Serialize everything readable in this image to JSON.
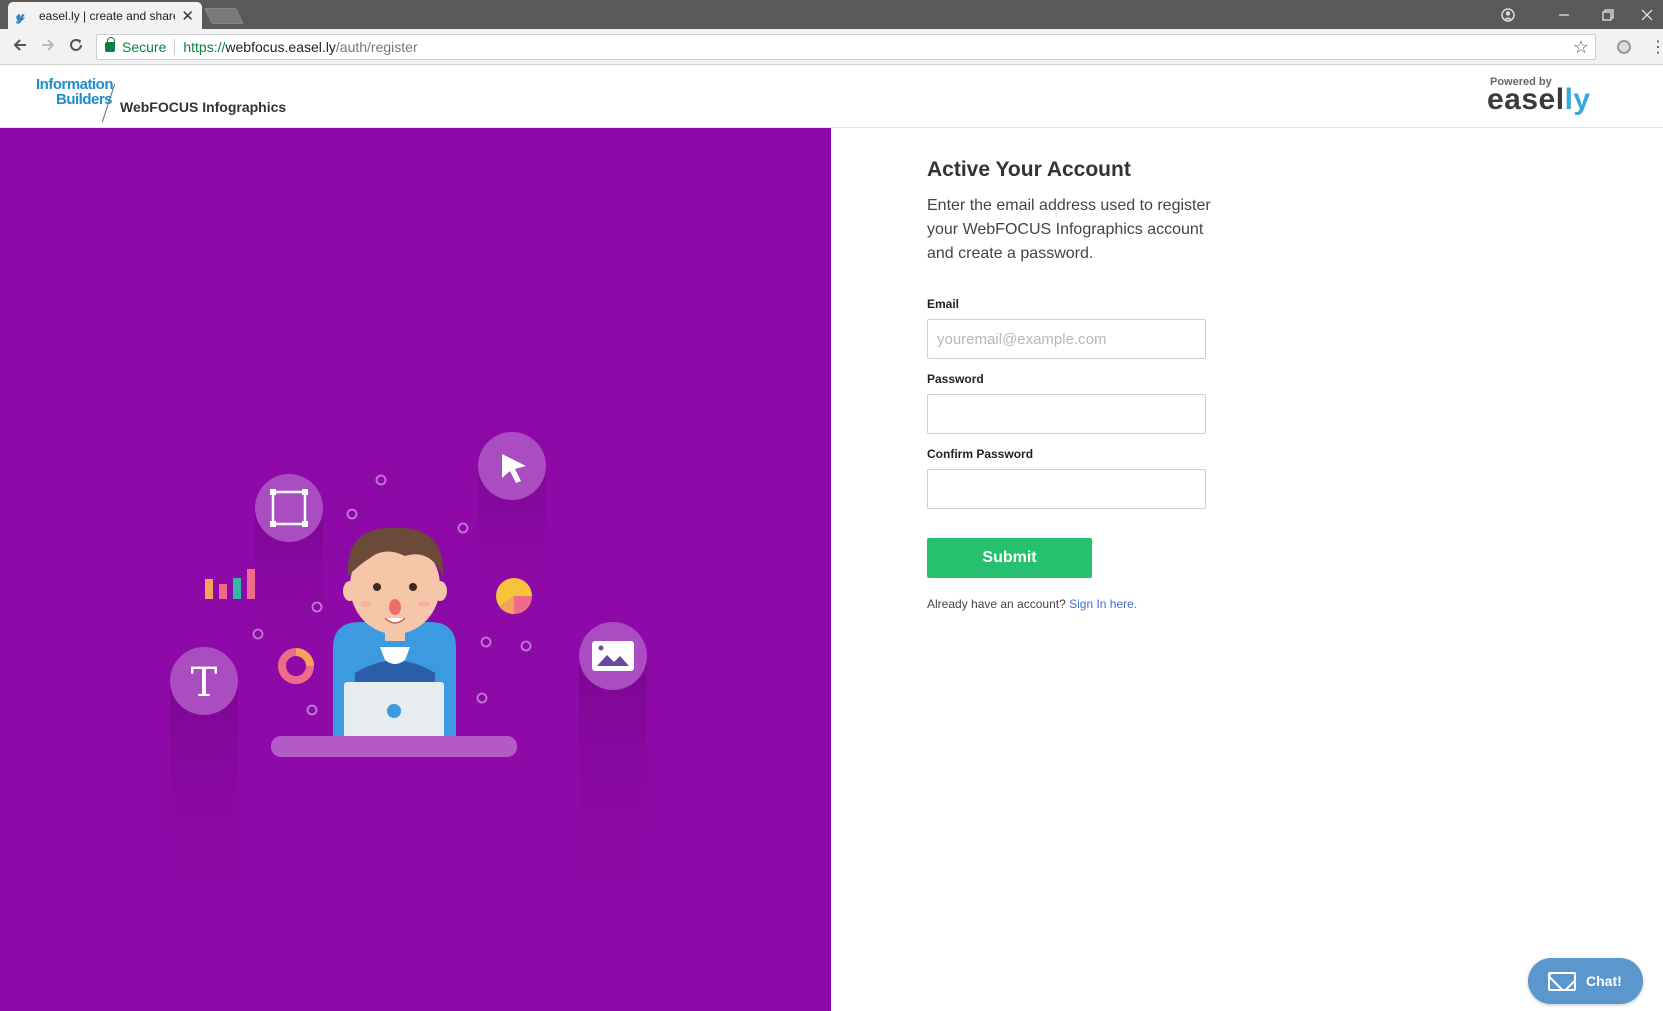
{
  "browser": {
    "tab_title": "easel.ly | create and share",
    "tab_close": "✕",
    "secure_label": "Secure",
    "url_scheme": "https://",
    "url_host": "webfocus.easel.ly",
    "url_path": "/auth/register"
  },
  "header": {
    "ib_logo_line1": "Information",
    "ib_logo_line2": "Builders",
    "product_name": "WebFOCUS Infographics",
    "powered_by": "Powered by",
    "brand_main": "easel",
    "brand_accent": "ly"
  },
  "hero": {
    "text_bubble_glyph": "T",
    "bg_color": "#8e0aa8"
  },
  "form": {
    "title": "Active Your Account",
    "description": "Enter the email address used to register your WebFOCUS Infographics account and create a password.",
    "email_label": "Email",
    "email_placeholder": "youremail@example.com",
    "email_value": "",
    "password_label": "Password",
    "password_value": "",
    "confirm_label": "Confirm Password",
    "confirm_value": "",
    "submit_label": "Submit",
    "signin_prompt": "Already have an account?",
    "signin_link": "Sign In here."
  },
  "chat": {
    "label": "Chat!"
  },
  "colors": {
    "accent_green": "#25c16f",
    "link_blue": "#3f6ed8",
    "chat_blue": "#5b96cd"
  }
}
